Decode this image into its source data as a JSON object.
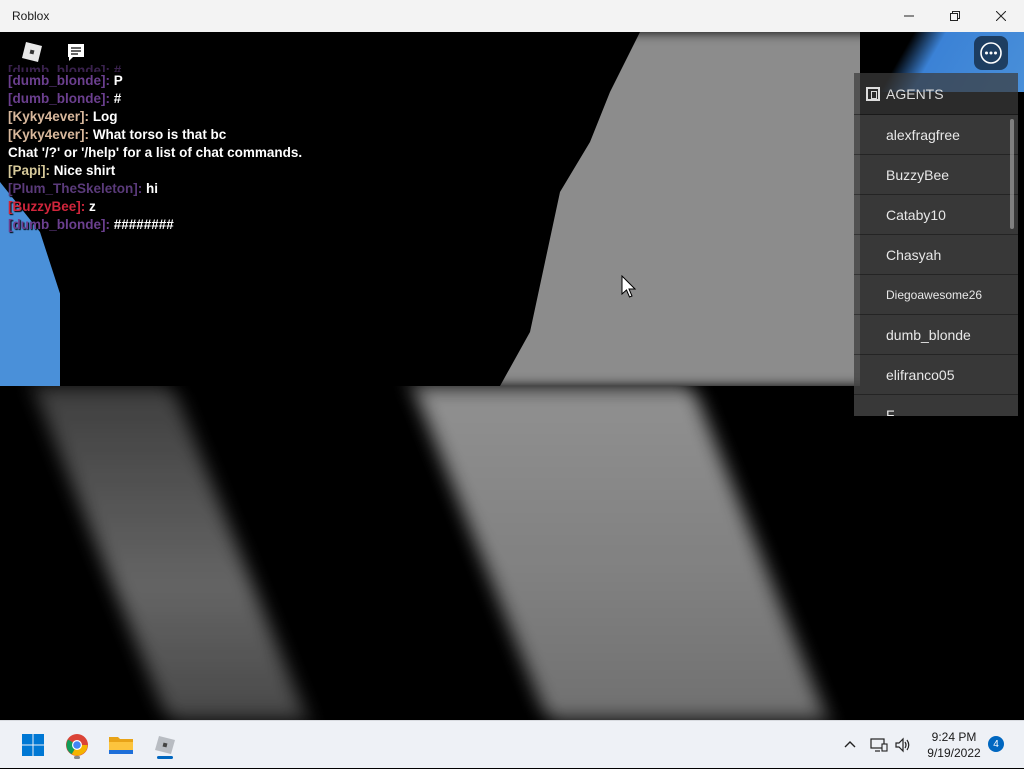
{
  "window": {
    "title": "Roblox",
    "minimize_glyph": "—",
    "maximize_glyph": "❐",
    "close_glyph": "✕"
  },
  "chat": {
    "faded_line": "[dumb_blonde]: #..",
    "messages": [
      {
        "name": "[dumb_blonde]:",
        "text": "P",
        "color": "#6b3f8f"
      },
      {
        "name": "[dumb_blonde]:",
        "text": "#",
        "color": "#6b3f8f"
      },
      {
        "name": "[Kyky4ever]:",
        "text": "Log",
        "color": "#d8b89c"
      },
      {
        "name": "[Kyky4ever]:",
        "text": "What torso is that bc",
        "color": "#d8b89c"
      },
      {
        "name": "",
        "text": "Chat '/?' or '/help' for a list of chat commands.",
        "color": "#ffffff"
      },
      {
        "name": "[Papi]:",
        "text": "Nice shirt",
        "color": "#d6c99a"
      },
      {
        "name": "[Plum_TheSkeleton]:",
        "text": "hi",
        "color": "#5a3a7a"
      },
      {
        "name": "[BuzzyBee]:",
        "text": "z",
        "color": "#d0253b"
      },
      {
        "name": "[dumb_blonde]:",
        "text": "########",
        "color": "#6b3f8f"
      }
    ]
  },
  "players": {
    "team_label": "AGENTS",
    "items": [
      "alexfragfree",
      "BuzzyBee",
      "Cataby10",
      "Chasyah",
      "Diegoawesome26",
      "dumb_blonde",
      "elifranco05",
      "F..."
    ]
  },
  "taskbar": {
    "time": "9:24 PM",
    "date": "9/19/2022",
    "notification_count": "4"
  },
  "colors": {
    "accent": "#0067c0",
    "sky": "#4a90d9"
  }
}
